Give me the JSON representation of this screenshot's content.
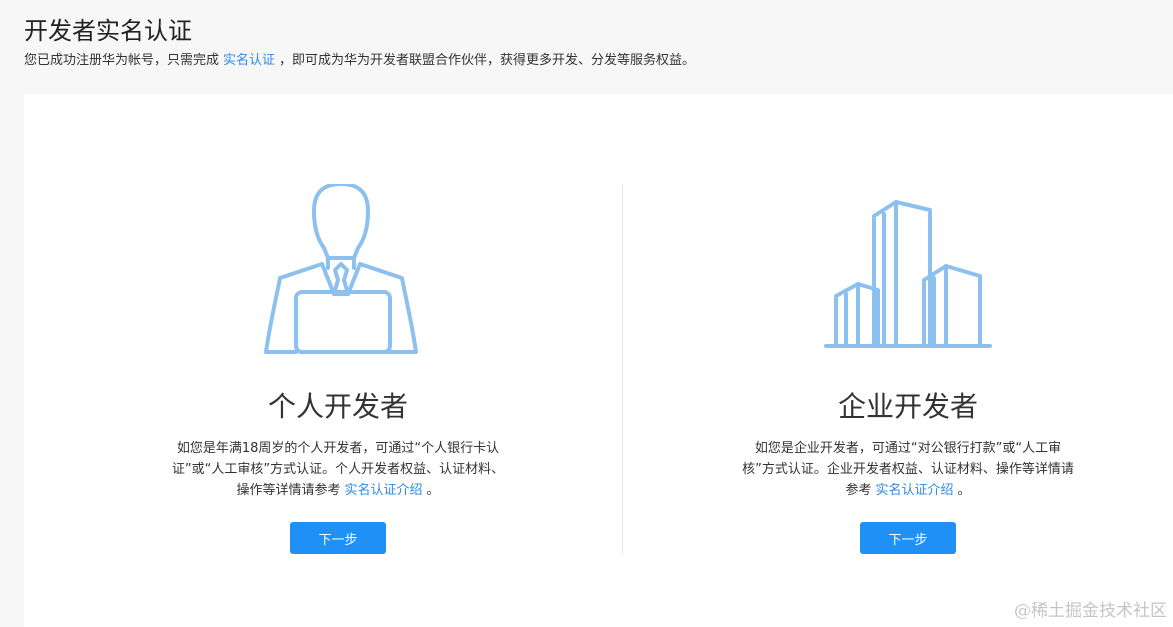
{
  "header": {
    "title": "开发者实名认证",
    "intro_before": "您已成功注册华为帐号，只需完成",
    "intro_link": "实名认证",
    "intro_after": "，即可成为华为开发者联盟合作伙伴，获得更多开发、分发等服务权益。"
  },
  "options": [
    {
      "title": "个人开发者",
      "desc_text": "如您是年满18周岁的个人开发者，可通过“个人银行卡认证”或“人工审核”方式认证。个人开发者权益、认证材料、操作等详情请参考",
      "desc_link": "实名认证介绍",
      "desc_end": "。",
      "button": "下一步",
      "icon": "developer-person-icon"
    },
    {
      "title": "企业开发者",
      "desc_text": "如您是企业开发者，可通过“对公银行打款”或“人工审核”方式认证。企业开发者权益、认证材料、操作等详情请参考",
      "desc_link": "实名认证介绍",
      "desc_end": "。",
      "button": "下一步",
      "icon": "enterprise-buildings-icon"
    }
  ],
  "watermark": "@稀土掘金技术社区",
  "colors": {
    "accent": "#1e90f6",
    "link": "#2d8ce6",
    "illustration": "#8cc0ef"
  }
}
